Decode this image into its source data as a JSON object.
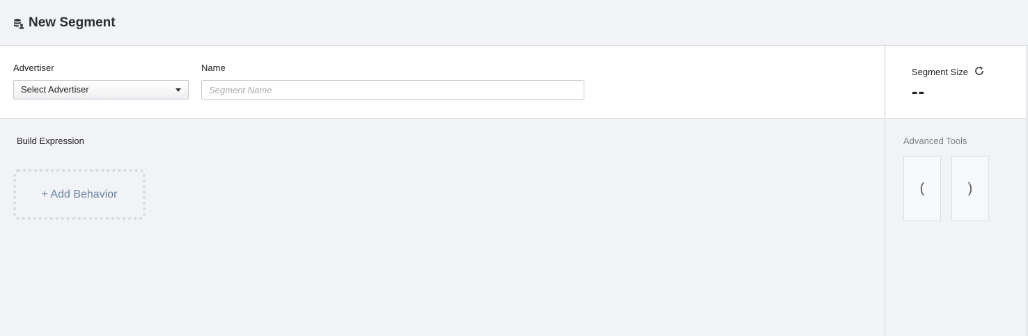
{
  "header": {
    "title": "New Segment",
    "icon": "database-user-icon"
  },
  "form": {
    "advertiser_label": "Advertiser",
    "advertiser_value": "Select Advertiser",
    "name_label": "Name",
    "name_placeholder": "Segment Name",
    "name_value": ""
  },
  "segment_size": {
    "label": "Segment Size",
    "value": "--",
    "refresh_icon": "refresh-icon"
  },
  "build": {
    "title": "Build Expression",
    "add_behavior_label": "+ Add Behavior"
  },
  "tools": {
    "title": "Advanced Tools",
    "open_paren": "(",
    "close_paren": ")"
  },
  "colors": {
    "link": "#6a84a6",
    "border": "#d9dbe0",
    "background": "#f2f3f6"
  }
}
